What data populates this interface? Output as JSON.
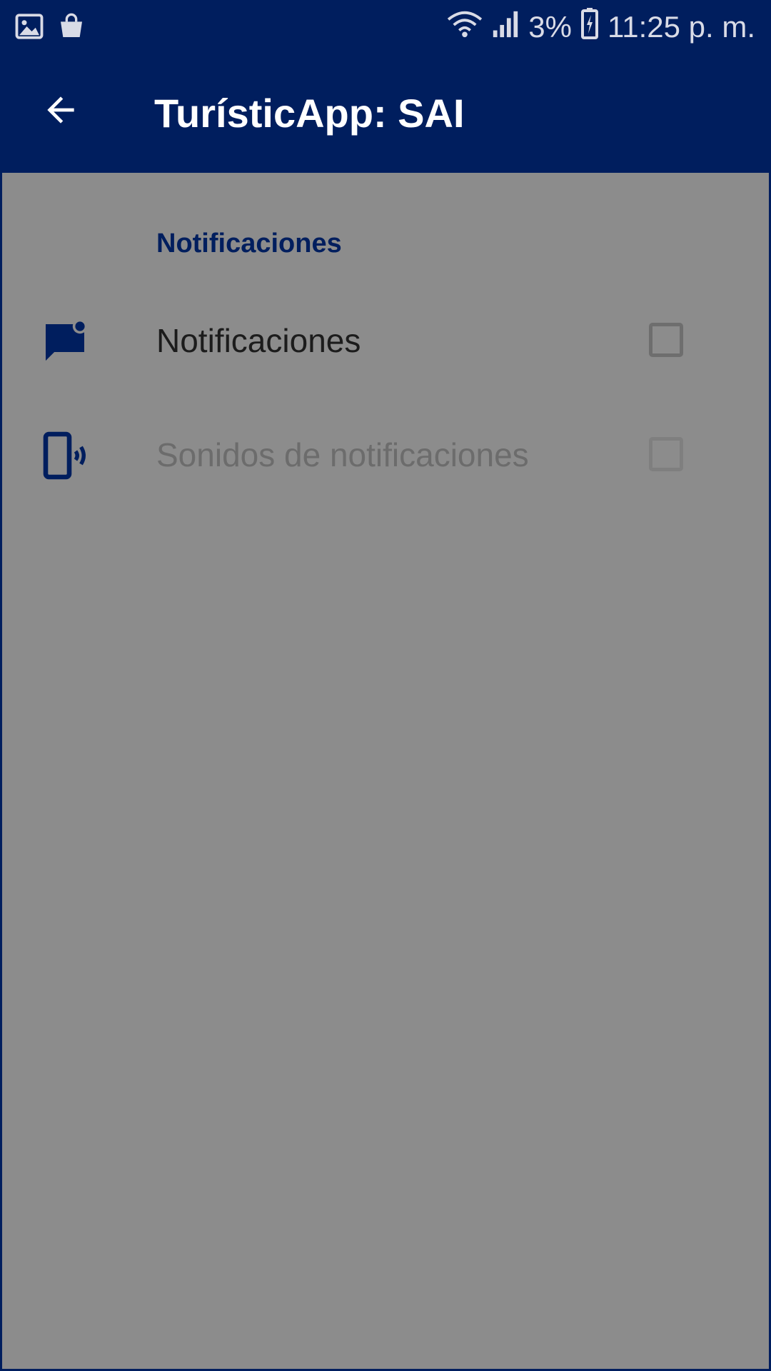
{
  "status_bar": {
    "icons_left": [
      "image-icon",
      "shopping-bag-icon"
    ],
    "battery_percent": "3%",
    "time": "11:25 p. m."
  },
  "app_bar": {
    "title": "TurísticApp: SAI",
    "back_icon": "arrow-back-icon"
  },
  "settings": {
    "section_title": "Notificaciones",
    "items": [
      {
        "label": "Notificaciones",
        "icon": "notification-message-icon",
        "checked": false,
        "enabled": true
      },
      {
        "label": "Sonidos de notificaciones",
        "icon": "phone-vibrate-icon",
        "checked": false,
        "enabled": false
      }
    ]
  },
  "colors": {
    "primary": "#001e5e",
    "scrim_background": "#8c8c8c",
    "text": "#1c1c1c"
  }
}
